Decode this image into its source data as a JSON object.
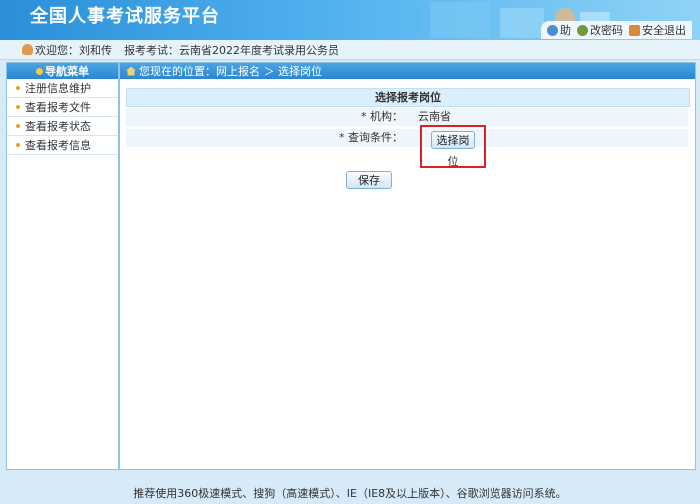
{
  "header": {
    "site_title": "全国人事考试服务平台",
    "links": [
      {
        "label": "助",
        "icon": "help-icon"
      },
      {
        "label": "改密码",
        "icon": "key-icon"
      },
      {
        "label": "安全退出",
        "icon": "exit-icon"
      }
    ]
  },
  "welcome": {
    "user_text": "欢迎您：刘和传",
    "exam_text": "报考考试：云南省2022年度考试录用公务员"
  },
  "sidebar": {
    "title": "导航菜单",
    "items": [
      {
        "label": "注册信息维护"
      },
      {
        "label": "查看报考文件"
      },
      {
        "label": "查看报考状态"
      },
      {
        "label": "查看报考信息"
      }
    ]
  },
  "breadcrumb": {
    "text": "您现在的位置：网上报名 ＞ 选择岗位"
  },
  "form": {
    "title": "选择报考岗位",
    "org_label": "* 机构：",
    "org_value": "云南省",
    "query_label": "* 查询条件：",
    "select_button": "选择岗",
    "select_button_tail": "位",
    "save_button": "保存"
  },
  "footer": {
    "text": "推荐使用360极速模式、搜狗（高速模式）、IE（IE8及以上版本）、谷歌浏览器访问系统。"
  },
  "colors": {
    "accent": "#2b86cf",
    "highlight": "#e02020"
  }
}
